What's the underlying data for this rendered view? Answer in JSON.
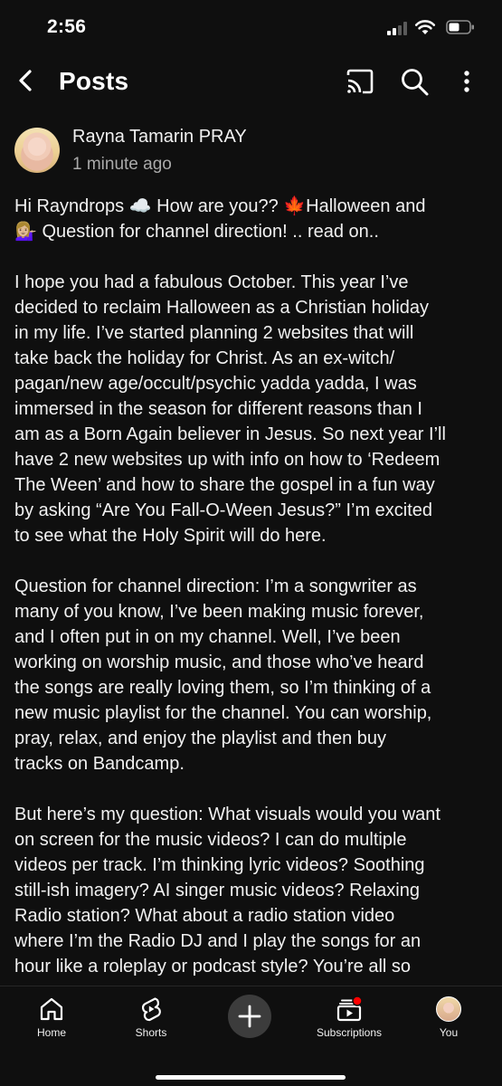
{
  "status_bar": {
    "time": "2:56"
  },
  "header": {
    "title": "Posts",
    "icons": [
      "back-arrow-icon",
      "cast-icon",
      "search-icon",
      "more-vertical-icon"
    ]
  },
  "post": {
    "author": "Rayna Tamarin PRAY",
    "time_ago": "1 minute ago",
    "paragraphs": [
      [
        "Hi Rayndrops ☁️ How are you?? 🍁Halloween and",
        "💁🏼‍♀️ Question for channel direction! .. read on.."
      ],
      [
        "I hope you had a fabulous October. This year I’ve",
        "decided to reclaim Halloween as a Christian holiday",
        "in my life. I’ve started planning 2 websites that will",
        "take back the holiday for Christ. As an ex-witch/",
        "pagan/new age/occult/psychic yadda yadda, I was",
        "immersed in the season for different reasons than I",
        "am as a Born Again believer in Jesus. So next year I’ll",
        "have 2 new websites up with info on how to ‘Redeem",
        "The Ween’ and how to share the gospel in a fun way",
        "by asking “Are You Fall-O-Ween Jesus?” I’m excited",
        "to see what the Holy Spirit will do here."
      ],
      [
        "Question for channel direction: I’m a songwriter as",
        "many of you know, I’ve been making music forever,",
        "and I often put in on my channel. Well, I’ve been",
        "working on worship music, and those who’ve heard",
        "the songs are really loving them, so I’m thinking of a",
        "new music playlist for the channel. You can worship,",
        "pray, relax, and enjoy  the playlist and then buy",
        "tracks on Bandcamp."
      ],
      [
        "But here’s my question: What visuals would you want",
        "on screen for the music videos? I can do multiple",
        "videos per track. I’m thinking lyric videos? Soothing",
        "still-ish imagery? AI singer music videos? Relaxing",
        "Radio station? What about a radio station video",
        "where I’m the Radio DJ and I play the songs for an",
        "hour like a roleplay or podcast style? You’re all so"
      ]
    ]
  },
  "bottom_nav": {
    "home": "Home",
    "shorts": "Shorts",
    "subscriptions": "Subscriptions",
    "you": "You",
    "subscriptions_badge_color": "#ff0000"
  },
  "colors": {
    "background": "#0f0f0f",
    "text": "#f1f1f1",
    "secondary_text": "#aaaaaa"
  }
}
